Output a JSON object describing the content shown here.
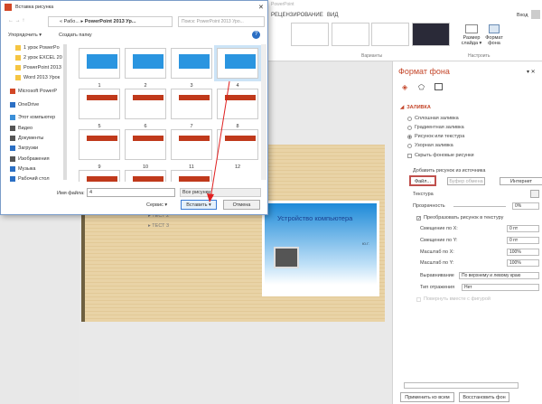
{
  "app": {
    "title": "PowerPoint",
    "tabs": [
      "РЕЦЕНЗИРОВАНИЕ",
      "ВИД"
    ],
    "user": "Вход",
    "groups": [
      "Варианты",
      "Настроить"
    ],
    "customize": [
      {
        "label": "Размер слайда ▾",
        "icon": "slide-size-icon"
      },
      {
        "label": "Формат фона",
        "icon": "format-background-icon"
      }
    ],
    "theme_colors": [
      "#f3ece0",
      "#f1ead9",
      "#e8eef8",
      "#2a2a38"
    ]
  },
  "slide": {
    "bullets": [
      "ТЕСТ 2",
      "ТЕСТ 3"
    ],
    "embedded_title": "Устройство компьютера",
    "embedded_sub": "Ю.Г."
  },
  "panel": {
    "title": "Формат фона",
    "section": "ЗАЛИВКА",
    "fill_options": [
      {
        "label": "Сплошная заливка",
        "selected": false
      },
      {
        "label": "Градиентная заливка",
        "selected": false
      },
      {
        "label": "Рисунок или текстура",
        "selected": true
      },
      {
        "label": "Узорная заливка",
        "selected": false
      }
    ],
    "hide_bg": "Скрыть фоновые рисунки",
    "insert_from": "Добавить рисунок из источника",
    "file_btn": "Файл...",
    "clipboard_btn": "Буфер обмена",
    "internet_btn": "Интернет",
    "texture": "Текстура",
    "transparency_label": "Прозрачность",
    "transparency": "0%",
    "tile": "Преобразовать рисунок в текстуру",
    "fields": [
      {
        "label": "Смещение по X:",
        "value": "0 пт"
      },
      {
        "label": "Смещение по Y:",
        "value": "0 пт"
      },
      {
        "label": "Масштаб по X:",
        "value": "100%"
      },
      {
        "label": "Масштаб по Y:",
        "value": "100%"
      }
    ],
    "align_label": "Выравнивание",
    "align_value": "По верхнему и левому краю",
    "mirror_label": "Тип отражения",
    "mirror_value": "Нет",
    "rotate": "Повернуть вместе с фигурой",
    "apply_all": "Применить ко всем",
    "reset": "Восстановить фон"
  },
  "dialog": {
    "title": "Вставка рисунка",
    "path": [
      "Рабо...",
      "PowerPoint 2013 Ур..."
    ],
    "search_placeholder": "Поиск: PowerPoint 2013 Уро...",
    "organize": "Упорядочить ▾",
    "new_folder": "Создать папку",
    "nav": [
      {
        "label": "1 урок PowerPo",
        "icon": "folder-icon"
      },
      {
        "label": "2 урок EXCEL 20",
        "icon": "folder-icon"
      },
      {
        "label": "PowerPoint 2013",
        "icon": "folder-icon"
      },
      {
        "label": "Word 2013 Урок",
        "icon": "folder-icon"
      },
      {
        "label": "Microsoft PowerP",
        "icon": "powerpoint-icon"
      },
      {
        "label": "OneDrive",
        "icon": "cloud-icon"
      },
      {
        "label": "Этот компьютер",
        "icon": "computer-icon"
      },
      {
        "label": "Видео",
        "icon": "video-icon"
      },
      {
        "label": "Документы",
        "icon": "documents-icon"
      },
      {
        "label": "Загрузки",
        "icon": "download-icon"
      },
      {
        "label": "Изображения",
        "icon": "pictures-icon"
      },
      {
        "label": "Музыка",
        "icon": "music-icon"
      },
      {
        "label": "Рабочий стол",
        "icon": "desktop-icon"
      }
    ],
    "files": [
      "1",
      "2",
      "3",
      "4",
      "5",
      "6",
      "7",
      "8",
      "9",
      "10",
      "11",
      "12",
      "",
      "",
      ""
    ],
    "selected_file": "4",
    "filename_label": "Имя файла:",
    "filename": "4",
    "filetype": "Все рисунки",
    "tools": "Сервис",
    "insert": "Вставить",
    "cancel": "Отмена"
  }
}
